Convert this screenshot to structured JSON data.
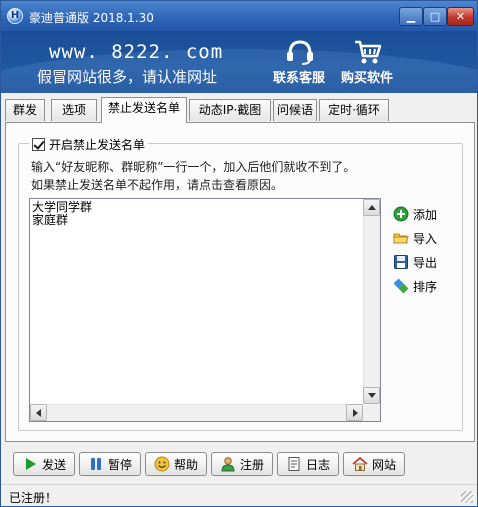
{
  "window": {
    "title": "豪迪普通版 2018.1.30",
    "app_icon_letter": "H"
  },
  "banner": {
    "url": "www. 8222. com",
    "slogan": "假冒网站很多，请认准网址",
    "links": [
      {
        "label": "联系客服",
        "icon": "headset-icon"
      },
      {
        "label": "购买软件",
        "icon": "shopping-cart-icon"
      }
    ]
  },
  "tabs": [
    {
      "label": "群发",
      "active": false
    },
    {
      "label": "选项",
      "active": false
    },
    {
      "label": "禁止发送名单",
      "active": true
    },
    {
      "label": "动态IP·截图",
      "active": false
    },
    {
      "label": "问候语",
      "active": false
    },
    {
      "label": "定时·循环",
      "active": false
    }
  ],
  "blocklist": {
    "enable_label": "开启禁止发送名单",
    "enabled": true,
    "instruction_line1": "输入“好友昵称、群昵称”一行一个，加入后他们就收不到了。",
    "instruction_line2": "如果禁止发送名单不起作用，请点击查看原因。",
    "entries": [
      "大学同学群",
      "家庭群"
    ],
    "actions": [
      {
        "label": "添加",
        "icon": "add-icon"
      },
      {
        "label": "导入",
        "icon": "folder-icon"
      },
      {
        "label": "导出",
        "icon": "save-icon"
      },
      {
        "label": "排序",
        "icon": "sort-icon"
      }
    ]
  },
  "toolbar": {
    "buttons": [
      {
        "label": "发送",
        "icon": "play-icon"
      },
      {
        "label": "暂停",
        "icon": "pause-icon"
      },
      {
        "label": "帮助",
        "icon": "help-icon"
      },
      {
        "label": "注册",
        "icon": "user-icon"
      },
      {
        "label": "日志",
        "icon": "log-icon"
      },
      {
        "label": "网站",
        "icon": "home-icon"
      }
    ]
  },
  "status": {
    "text": "已注册！"
  },
  "colors": {
    "titlebar": "#2f66b8",
    "banner": "#1a4e98",
    "panel": "#fcfcfc",
    "add_green": "#2e9e3a",
    "play_green": "#1f9a2b"
  }
}
